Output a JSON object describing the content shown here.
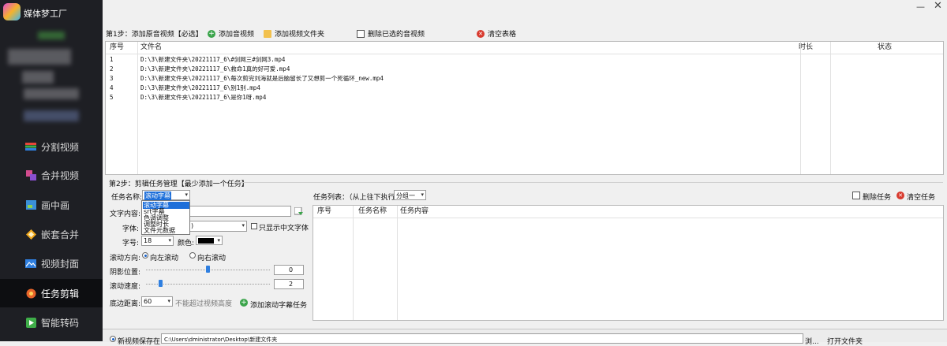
{
  "app": {
    "title": "媒体梦工厂"
  },
  "sidebar": {
    "items": [
      {
        "label": "分割视频",
        "icon": "split-video-icon"
      },
      {
        "label": "合并视频",
        "icon": "merge-video-icon"
      },
      {
        "label": "画中画",
        "icon": "pip-icon"
      },
      {
        "label": "嵌套合并",
        "icon": "nest-merge-icon"
      },
      {
        "label": "视频封面",
        "icon": "video-cover-icon"
      },
      {
        "label": "任务剪辑",
        "icon": "task-edit-icon",
        "active": true
      },
      {
        "label": "智能转码",
        "icon": "transcode-icon"
      }
    ]
  },
  "step1": {
    "title": "第1步：添加原音视频【必选】",
    "buttons": {
      "add_media": "添加音视频",
      "add_folder": "添加视频文件夹",
      "delete_selected": "删除已选的音视频",
      "clear_table": "清空表格"
    },
    "columns": {
      "index": "序号",
      "filename": "文件名",
      "duration": "时长",
      "status": "状态"
    },
    "rows": [
      {
        "index": "1",
        "filename": "D:\\3\\新建文件夹\\20221117_6\\#剑网三#剑网3.mp4"
      },
      {
        "index": "2",
        "filename": "D:\\3\\新建文件夹\\20221117_6\\救命1真的好可爱.mp4"
      },
      {
        "index": "3",
        "filename": "D:\\3\\新建文件夹\\20221117_6\\每次剪完刘海就是后脑留长了又想剪一个死循环_new.mp4"
      },
      {
        "index": "4",
        "filename": "D:\\3\\新建文件夹\\20221117_6\\别1别.mp4"
      },
      {
        "index": "5",
        "filename": "D:\\3\\新建文件夹\\20221117_6\\是你1呀.mp4"
      }
    ]
  },
  "step2": {
    "title": "第2步：剪辑任务管理【最少添加一个任务】",
    "task_name_label": "任务名称:",
    "task_name_value": "滚动字幕",
    "dropdown_options": [
      "滚动字幕",
      "srt字幕",
      "色调调整",
      "调整时长",
      "文件元数据"
    ],
    "text_content_label": "文字内容:",
    "font_label": "字体:",
    "font_value": ")",
    "only_chinese_label": "只显示中文字体",
    "size_label": "字号:",
    "size_value": "18",
    "color_label": "颜色:",
    "color_value": "#000000",
    "direction_label": "滚动方向:",
    "direction_left": "向左滚动",
    "direction_right": "向右滚动",
    "shadow_label": "阴影位置:",
    "shadow_value": "0",
    "speed_label": "滚动速度:",
    "speed_value": "2",
    "bottom_distance_label": "底边距离:",
    "bottom_distance_value": "60",
    "bottom_hint": "不能超过视频高度",
    "add_task_button": "添加滚动字幕任务"
  },
  "tasks": {
    "list_label": "任务列表：（从上往下执行）",
    "group_value": "分组一",
    "delete_button": "删除任务",
    "clear_button": "清空任务",
    "columns": {
      "index": "序号",
      "name": "任务名称",
      "content": "任务内容"
    }
  },
  "bottom": {
    "save_label": "新视频保存在:",
    "save_path": "C:\\Users\\dministrator\\Desktop\\新建文件夹",
    "browse_label": "浏...",
    "open_folder_label": "打开文件夹"
  },
  "colors": {
    "sidebar_bg": "#1e1f24",
    "accent": "#1e6fd9",
    "delete_red": "#d83b2f",
    "add_green": "#3aa44a"
  }
}
